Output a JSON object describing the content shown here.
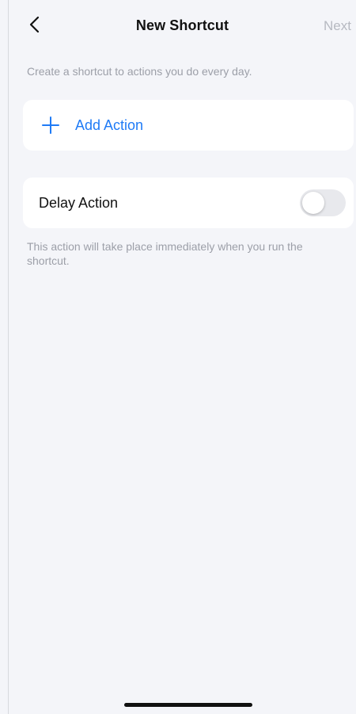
{
  "nav": {
    "title": "New Shortcut",
    "next_label": "Next",
    "back_icon": "chevron-left-icon"
  },
  "intro": {
    "text": "Create a shortcut to actions you do every day."
  },
  "add_action": {
    "label": "Add Action",
    "icon": "plus-icon",
    "color": "#1f7bf6"
  },
  "delay_action": {
    "label": "Delay Action",
    "enabled": false,
    "note": "This action will take place immediately when you run the shortcut."
  },
  "colors": {
    "background": "#f4f5f9",
    "card": "#ffffff",
    "accent": "#1f7bf6",
    "muted": "#9c9fa8",
    "disabled_nav": "#b6b9c1"
  }
}
